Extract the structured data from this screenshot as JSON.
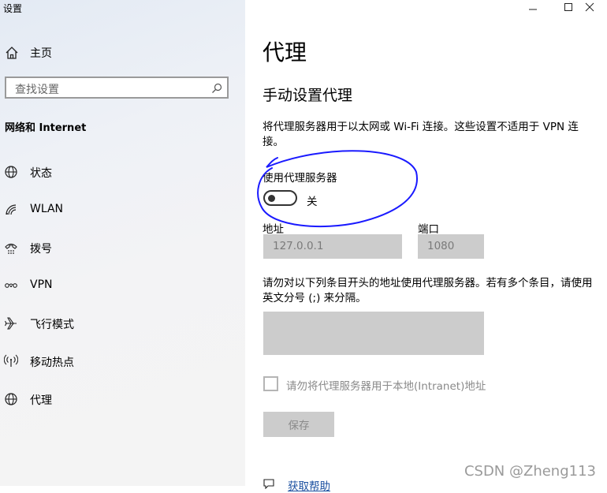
{
  "window": {
    "title": "设置"
  },
  "sidebar": {
    "home_label": "主页",
    "search_placeholder": "查找设置",
    "section_title": "网络和 Internet",
    "items": [
      {
        "label": "状态",
        "icon": "globe-icon"
      },
      {
        "label": "WLAN",
        "icon": "wifi-icon"
      },
      {
        "label": "拨号",
        "icon": "dialup-icon"
      },
      {
        "label": "VPN",
        "icon": "vpn-icon"
      },
      {
        "label": "飞行模式",
        "icon": "airplane-icon"
      },
      {
        "label": "移动热点",
        "icon": "hotspot-icon"
      },
      {
        "label": "代理",
        "icon": "globe-icon"
      }
    ]
  },
  "main": {
    "title": "代理",
    "subtitle": "手动设置代理",
    "description": "将代理服务器用于以太网或 Wi-Fi 连接。这些设置不适用于 VPN 连接。",
    "use_proxy_label": "使用代理服务器",
    "toggle_state": "关",
    "toggle_on": false,
    "address_label": "地址",
    "address_value": "127.0.0.1",
    "port_label": "端口",
    "port_value": "1080",
    "exceptions_desc": "请勿对以下列条目开头的地址使用代理服务器。若有多个条目，请使用英文分号 (;) 来分隔。",
    "exceptions_value": "",
    "local_bypass_label": "请勿将代理服务器用于本地(Intranet)地址",
    "local_bypass_checked": false,
    "save_label": "保存",
    "help_link": "获取帮助"
  },
  "watermark": "CSDN @Zheng113",
  "colors": {
    "annotation": "#1a1aff",
    "disabled_field": "#cccccc",
    "link": "#1a4fa0"
  }
}
